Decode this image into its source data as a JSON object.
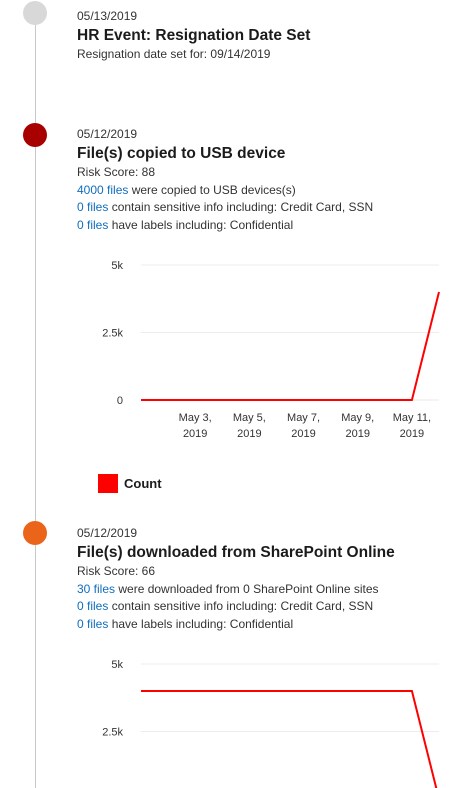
{
  "events": [
    {
      "date": "05/13/2019",
      "title": "HR Event: Resignation Date Set",
      "detail": "Resignation date set for: 09/14/2019",
      "dot_color": "#d8d8d8"
    },
    {
      "date": "05/12/2019",
      "title": "File(s) copied to USB device",
      "risk_score": "Risk Score: 88",
      "line1_link": "4000 files",
      "line1_text": " were copied to USB devices(s)",
      "line2_link": "0 files",
      "line2_text": " contain sensitive info including: Credit Card, SSN",
      "line3_link": "0 files",
      "line3_text": " have labels including: Confidential",
      "dot_color": "#a80000"
    },
    {
      "date": "05/12/2019",
      "title": "File(s) downloaded from SharePoint Online",
      "risk_score": "Risk Score: 66",
      "line1_link": "30 files",
      "line1_text": " were downloaded from 0 SharePoint Online sites",
      "line2_link": "0 files",
      "line2_text": " contain sensitive info including: Credit Card, SSN",
      "line3_link": "0 files",
      "line3_text": " have labels including: Confidential",
      "dot_color": "#ea6419"
    }
  ],
  "legend": {
    "label": "Count",
    "color": "#ff0000"
  },
  "chart_data": [
    {
      "type": "line",
      "x": [
        "May 1, 2019",
        "May 2, 2019",
        "May 3, 2019",
        "May 4, 2019",
        "May 5, 2019",
        "May 6, 2019",
        "May 7, 2019",
        "May 8, 2019",
        "May 9, 2019",
        "May 10, 2019",
        "May 11, 2019",
        "May 12, 2019"
      ],
      "series": [
        {
          "name": "Count",
          "values": [
            0,
            0,
            0,
            0,
            0,
            0,
            0,
            0,
            0,
            0,
            0,
            4000
          ]
        }
      ],
      "yticks": [
        "5k",
        "2.5k",
        "0"
      ],
      "ytick_values": [
        5000,
        2500,
        0
      ],
      "xticks": [
        {
          "line1": "May 3,",
          "line2": "2019",
          "x": "May 3, 2019"
        },
        {
          "line1": "May 5,",
          "line2": "2019",
          "x": "May 5, 2019"
        },
        {
          "line1": "May 7,",
          "line2": "2019",
          "x": "May 7, 2019"
        },
        {
          "line1": "May 9,",
          "line2": "2019",
          "x": "May 9, 2019"
        },
        {
          "line1": "May 11,",
          "line2": "2019",
          "x": "May 11, 2019"
        }
      ],
      "ylim": [
        0,
        5000
      ],
      "line_color": "#ff0000"
    },
    {
      "type": "line",
      "x": [
        "May 1, 2019",
        "May 2, 2019",
        "May 3, 2019",
        "May 4, 2019",
        "May 5, 2019",
        "May 6, 2019",
        "May 7, 2019",
        "May 8, 2019",
        "May 9, 2019",
        "May 10, 2019",
        "May 11, 2019",
        "May 12, 2019"
      ],
      "series": [
        {
          "name": "Count",
          "values": [
            4000,
            4000,
            4000,
            4000,
            4000,
            4000,
            4000,
            4000,
            4000,
            4000,
            4000,
            0
          ]
        }
      ],
      "yticks": [
        "5k",
        "2.5k"
      ],
      "ytick_values": [
        5000,
        2500
      ],
      "ylim": [
        0,
        5000
      ],
      "line_color": "#ff0000"
    }
  ]
}
